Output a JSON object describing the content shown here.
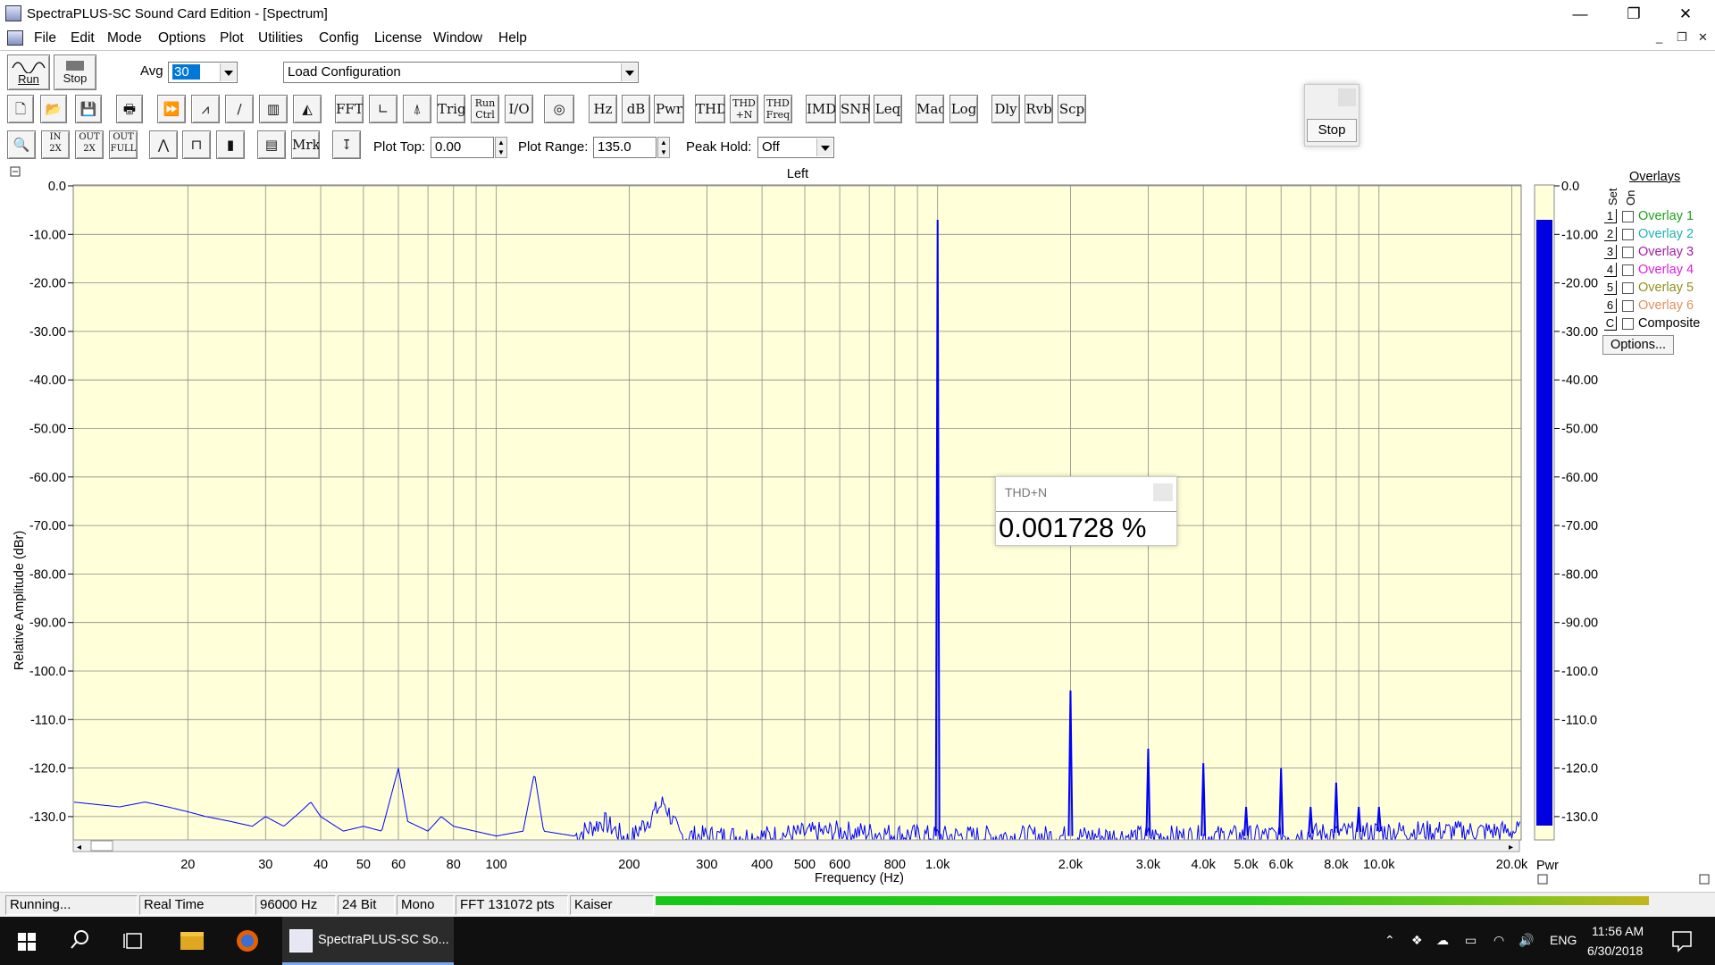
{
  "window": {
    "title": "SpectraPLUS-SC Sound Card Edition - [Spectrum]",
    "controls": {
      "minimize": "—",
      "restore": "❐",
      "close": "✕"
    }
  },
  "menu": [
    "File",
    "Edit",
    "Mode",
    "Options",
    "Plot",
    "Utilities",
    "Config",
    "License",
    "Window",
    "Help"
  ],
  "mdi_controls": {
    "minimize": "_",
    "restore": "❐",
    "close": "✕"
  },
  "toolbar": {
    "run_label": "Run",
    "stop_label": "Stop",
    "avg_label": "Avg",
    "avg_value": "30",
    "config_value": "Load Configuration",
    "row1_buttons": [
      "FFT",
      "Trig",
      "Run Ctrl",
      "I/O",
      "Hz",
      "dB",
      "Pwr",
      "THD",
      "THD +N",
      "THD Freq",
      "IMD",
      "SNR",
      "Leq",
      "Mac",
      "Log",
      "Dly",
      "Rvb",
      "Scp"
    ],
    "row2_buttons": [
      "Mrk"
    ],
    "plot_top_label": "Plot Top:",
    "plot_top_value": "0.00",
    "plot_range_label": "Plot Range:",
    "plot_range_value": "135.0",
    "peak_hold_label": "Peak Hold:",
    "peak_hold_value": "Off"
  },
  "stop_panel": {
    "button": "Stop"
  },
  "chart_data": {
    "type": "line",
    "title": "Left",
    "xlabel": "Frequency (Hz)",
    "ylabel": "Relative Amplitude (dBr)",
    "xscale": "log",
    "xlim": [
      11,
      21000
    ],
    "ylim": [
      -135,
      0
    ],
    "grid": true,
    "background": "#ffffd9",
    "line_color": "#0000ff",
    "y_ticks": [
      "0.0",
      "-10.00",
      "-20.00",
      "-30.00",
      "-40.00",
      "-50.00",
      "-60.00",
      "-70.00",
      "-80.00",
      "-90.00",
      "-100.0",
      "-110.0",
      "-120.0",
      "-130.0"
    ],
    "x_ticks": [
      {
        "v": 20,
        "label": "20"
      },
      {
        "v": 30,
        "label": "30"
      },
      {
        "v": 40,
        "label": "40"
      },
      {
        "v": 50,
        "label": "50"
      },
      {
        "v": 60,
        "label": "60"
      },
      {
        "v": 80,
        "label": "80"
      },
      {
        "v": 100,
        "label": "100"
      },
      {
        "v": 200,
        "label": "200"
      },
      {
        "v": 300,
        "label": "300"
      },
      {
        "v": 400,
        "label": "400"
      },
      {
        "v": 500,
        "label": "500"
      },
      {
        "v": 600,
        "label": "600"
      },
      {
        "v": 800,
        "label": "800"
      },
      {
        "v": 1000,
        "label": "1.0k"
      },
      {
        "v": 2000,
        "label": "2.0k"
      },
      {
        "v": 3000,
        "label": "3.0k"
      },
      {
        "v": 4000,
        "label": "4.0k"
      },
      {
        "v": 5000,
        "label": "5.0k"
      },
      {
        "v": 6000,
        "label": "6.0k"
      },
      {
        "v": 8000,
        "label": "8.0k"
      },
      {
        "v": 10000,
        "label": "10.0k"
      },
      {
        "v": 20000,
        "label": "20.0k"
      }
    ],
    "noise_floor": [
      [
        11,
        -127
      ],
      [
        14,
        -128
      ],
      [
        16,
        -127
      ],
      [
        18,
        -128
      ],
      [
        20,
        -129
      ],
      [
        22,
        -130
      ],
      [
        25,
        -131
      ],
      [
        28,
        -132
      ],
      [
        30,
        -130
      ],
      [
        33,
        -132
      ],
      [
        36,
        -129
      ],
      [
        38,
        -127
      ],
      [
        40,
        -130
      ],
      [
        45,
        -133
      ],
      [
        50,
        -132
      ],
      [
        55,
        -133
      ],
      [
        60,
        -120
      ],
      [
        63,
        -131
      ],
      [
        70,
        -133
      ],
      [
        75,
        -130
      ],
      [
        80,
        -132
      ],
      [
        100,
        -134
      ],
      [
        115,
        -133
      ],
      [
        122,
        -121
      ],
      [
        128,
        -133
      ],
      [
        150,
        -134
      ],
      [
        175,
        -131
      ],
      [
        200,
        -135
      ],
      [
        240,
        -127
      ],
      [
        260,
        -134
      ],
      [
        400,
        -134
      ],
      [
        600,
        -133
      ],
      [
        1000,
        -134
      ],
      [
        2000,
        -134
      ],
      [
        5000,
        -134
      ],
      [
        10000,
        -133
      ],
      [
        21000,
        -133
      ]
    ],
    "peaks": [
      {
        "f": 1000,
        "db": -7.0
      },
      {
        "f": 2000,
        "db": -104.0
      },
      {
        "f": 3000,
        "db": -116.0
      },
      {
        "f": 4000,
        "db": -119.0
      },
      {
        "f": 5000,
        "db": -128.0
      },
      {
        "f": 6000,
        "db": -120.0
      },
      {
        "f": 7000,
        "db": -128.0
      },
      {
        "f": 8000,
        "db": -123.0
      },
      {
        "f": 9000,
        "db": -128.0
      },
      {
        "f": 10000,
        "db": -128.0
      }
    ],
    "pwr_bar": {
      "label": "Pwr",
      "level_db": -7.0,
      "color": "#0000e0"
    },
    "right_ticks": [
      "0.0",
      "-10.00",
      "-20.00",
      "-30.00",
      "-40.00",
      "-50.00",
      "-60.00",
      "-70.00",
      "-80.00",
      "-90.00",
      "-100.0",
      "-110.0",
      "-120.0",
      "-130.0"
    ]
  },
  "overlays": {
    "title": "Overlays",
    "set_label": "Set",
    "on_label": "On",
    "items": [
      {
        "num": "1",
        "label": "Overlay 1",
        "color": "#20a020"
      },
      {
        "num": "2",
        "label": "Overlay 2",
        "color": "#20b0b0"
      },
      {
        "num": "3",
        "label": "Overlay 3",
        "color": "#a020a0"
      },
      {
        "num": "4",
        "label": "Overlay 4",
        "color": "#e020e0"
      },
      {
        "num": "5",
        "label": "Overlay 5",
        "color": "#909020"
      },
      {
        "num": "6",
        "label": "Overlay 6",
        "color": "#e09060"
      },
      {
        "num": "C",
        "label": "Composite",
        "color": "#000000"
      }
    ],
    "options_label": "Options..."
  },
  "thdn": {
    "title": "THD+N",
    "value": "0.001728 %"
  },
  "status": {
    "state": "Running...",
    "mode": "Real Time",
    "rate": "96000 Hz",
    "bits": "24 Bit",
    "channels": "Mono",
    "fft": "FFT 131072 pts",
    "window": "Kaiser"
  },
  "taskbar": {
    "app_label": "SpectraPLUS-SC So...",
    "lang": "ENG",
    "time": "11:56 AM",
    "date": "6/30/2018"
  }
}
